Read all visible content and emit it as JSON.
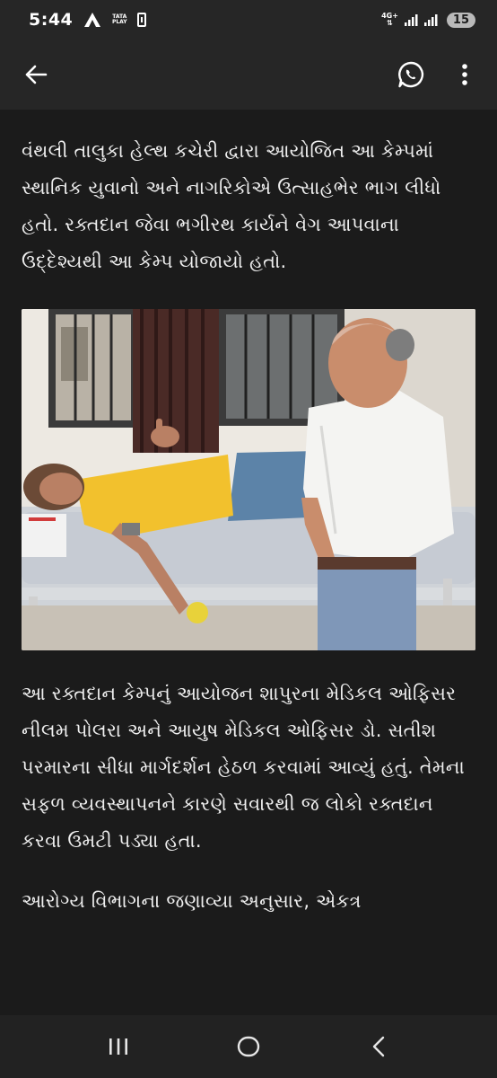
{
  "status_bar": {
    "time": "5:44",
    "carrier_icon": "airtel-icon",
    "tataplay_line1": "TATA",
    "tataplay_line2": "PLAY",
    "network_type": "4G+",
    "battery_level": "15"
  },
  "app_bar": {
    "back_icon": "arrow-left-icon",
    "share_icon": "whatsapp-icon",
    "menu_icon": "more-vert-icon"
  },
  "article": {
    "paragraph_1": "વંથલી તાલુકા હેલ્થ કચેરી દ્વારા આયોજિત આ કેમ્પમાં સ્થાનિક યુવાનો અને નાગરિકોએ ઉત્સાહભેર ભાગ લીધો હતો. રક્તદાન જેવા ભગીરથ કાર્યને વેગ આપવાના ઉદ્દેશ્યથી આ કેમ્પ યોજાયો હતો.",
    "paragraph_2": "આ રક્તદાન કેમ્પનું આયોજન શાપુરના મેડિકલ ઓફિસર નીલમ પોલરા અને આયુષ મેડિકલ ઓફિસર ડો. સતીશ પરમારના સીધા માર્ગદર્શન હેઠળ કરવામાં આવ્યું હતું. તેમના સફળ વ્યવસ્થાપનને કારણે સવારથી જ લોકો રક્તદાન કરવા ઉમટી પડ્યા હતા.",
    "paragraph_3": "આરોગ્ય વિભાગના જણાવ્યા અનુસાર, એકત્ર"
  },
  "nav_bar": {
    "recents_icon": "recents-icon",
    "home_icon": "home-circle-icon",
    "back_icon": "chevron-left-icon"
  }
}
